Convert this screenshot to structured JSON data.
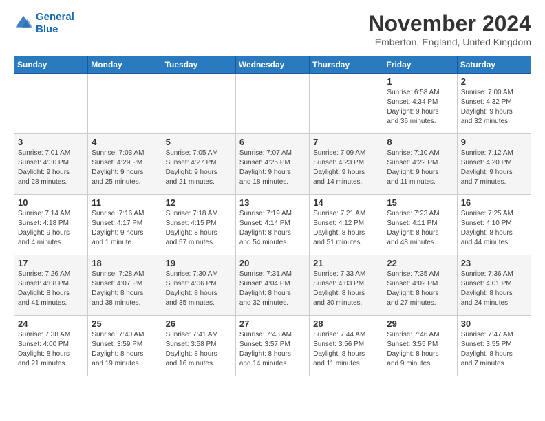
{
  "logo": {
    "line1": "General",
    "line2": "Blue"
  },
  "title": "November 2024",
  "subtitle": "Emberton, England, United Kingdom",
  "weekdays": [
    "Sunday",
    "Monday",
    "Tuesday",
    "Wednesday",
    "Thursday",
    "Friday",
    "Saturday"
  ],
  "weeks": [
    [
      {
        "day": "",
        "info": ""
      },
      {
        "day": "",
        "info": ""
      },
      {
        "day": "",
        "info": ""
      },
      {
        "day": "",
        "info": ""
      },
      {
        "day": "",
        "info": ""
      },
      {
        "day": "1",
        "info": "Sunrise: 6:58 AM\nSunset: 4:34 PM\nDaylight: 9 hours\nand 36 minutes."
      },
      {
        "day": "2",
        "info": "Sunrise: 7:00 AM\nSunset: 4:32 PM\nDaylight: 9 hours\nand 32 minutes."
      }
    ],
    [
      {
        "day": "3",
        "info": "Sunrise: 7:01 AM\nSunset: 4:30 PM\nDaylight: 9 hours\nand 28 minutes."
      },
      {
        "day": "4",
        "info": "Sunrise: 7:03 AM\nSunset: 4:29 PM\nDaylight: 9 hours\nand 25 minutes."
      },
      {
        "day": "5",
        "info": "Sunrise: 7:05 AM\nSunset: 4:27 PM\nDaylight: 9 hours\nand 21 minutes."
      },
      {
        "day": "6",
        "info": "Sunrise: 7:07 AM\nSunset: 4:25 PM\nDaylight: 9 hours\nand 18 minutes."
      },
      {
        "day": "7",
        "info": "Sunrise: 7:09 AM\nSunset: 4:23 PM\nDaylight: 9 hours\nand 14 minutes."
      },
      {
        "day": "8",
        "info": "Sunrise: 7:10 AM\nSunset: 4:22 PM\nDaylight: 9 hours\nand 11 minutes."
      },
      {
        "day": "9",
        "info": "Sunrise: 7:12 AM\nSunset: 4:20 PM\nDaylight: 9 hours\nand 7 minutes."
      }
    ],
    [
      {
        "day": "10",
        "info": "Sunrise: 7:14 AM\nSunset: 4:18 PM\nDaylight: 9 hours\nand 4 minutes."
      },
      {
        "day": "11",
        "info": "Sunrise: 7:16 AM\nSunset: 4:17 PM\nDaylight: 9 hours\nand 1 minute."
      },
      {
        "day": "12",
        "info": "Sunrise: 7:18 AM\nSunset: 4:15 PM\nDaylight: 8 hours\nand 57 minutes."
      },
      {
        "day": "13",
        "info": "Sunrise: 7:19 AM\nSunset: 4:14 PM\nDaylight: 8 hours\nand 54 minutes."
      },
      {
        "day": "14",
        "info": "Sunrise: 7:21 AM\nSunset: 4:12 PM\nDaylight: 8 hours\nand 51 minutes."
      },
      {
        "day": "15",
        "info": "Sunrise: 7:23 AM\nSunset: 4:11 PM\nDaylight: 8 hours\nand 48 minutes."
      },
      {
        "day": "16",
        "info": "Sunrise: 7:25 AM\nSunset: 4:10 PM\nDaylight: 8 hours\nand 44 minutes."
      }
    ],
    [
      {
        "day": "17",
        "info": "Sunrise: 7:26 AM\nSunset: 4:08 PM\nDaylight: 8 hours\nand 41 minutes."
      },
      {
        "day": "18",
        "info": "Sunrise: 7:28 AM\nSunset: 4:07 PM\nDaylight: 8 hours\nand 38 minutes."
      },
      {
        "day": "19",
        "info": "Sunrise: 7:30 AM\nSunset: 4:06 PM\nDaylight: 8 hours\nand 35 minutes."
      },
      {
        "day": "20",
        "info": "Sunrise: 7:31 AM\nSunset: 4:04 PM\nDaylight: 8 hours\nand 32 minutes."
      },
      {
        "day": "21",
        "info": "Sunrise: 7:33 AM\nSunset: 4:03 PM\nDaylight: 8 hours\nand 30 minutes."
      },
      {
        "day": "22",
        "info": "Sunrise: 7:35 AM\nSunset: 4:02 PM\nDaylight: 8 hours\nand 27 minutes."
      },
      {
        "day": "23",
        "info": "Sunrise: 7:36 AM\nSunset: 4:01 PM\nDaylight: 8 hours\nand 24 minutes."
      }
    ],
    [
      {
        "day": "24",
        "info": "Sunrise: 7:38 AM\nSunset: 4:00 PM\nDaylight: 8 hours\nand 21 minutes."
      },
      {
        "day": "25",
        "info": "Sunrise: 7:40 AM\nSunset: 3:59 PM\nDaylight: 8 hours\nand 19 minutes."
      },
      {
        "day": "26",
        "info": "Sunrise: 7:41 AM\nSunset: 3:58 PM\nDaylight: 8 hours\nand 16 minutes."
      },
      {
        "day": "27",
        "info": "Sunrise: 7:43 AM\nSunset: 3:57 PM\nDaylight: 8 hours\nand 14 minutes."
      },
      {
        "day": "28",
        "info": "Sunrise: 7:44 AM\nSunset: 3:56 PM\nDaylight: 8 hours\nand 11 minutes."
      },
      {
        "day": "29",
        "info": "Sunrise: 7:46 AM\nSunset: 3:55 PM\nDaylight: 8 hours\nand 9 minutes."
      },
      {
        "day": "30",
        "info": "Sunrise: 7:47 AM\nSunset: 3:55 PM\nDaylight: 8 hours\nand 7 minutes."
      }
    ]
  ]
}
